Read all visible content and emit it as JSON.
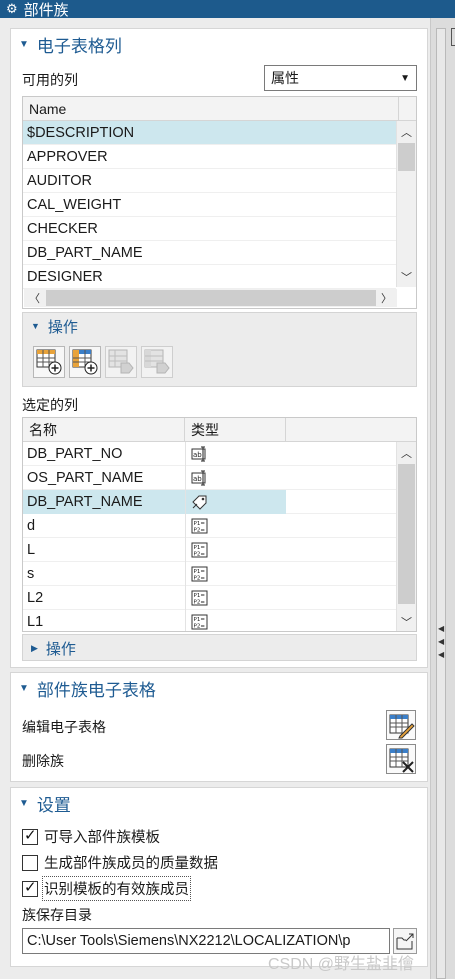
{
  "window": {
    "title": "部件族",
    "icon": "gear-icon"
  },
  "spreadsheet_columns": {
    "title": "电子表格列",
    "available_label": "可用的列",
    "dropdown_value": "属性",
    "available_header": "Name",
    "available_rows": [
      "$DESCRIPTION",
      "APPROVER",
      "AUDITOR",
      "CAL_WEIGHT",
      "CHECKER",
      "DB_PART_NAME",
      "DESIGNER"
    ],
    "selected_available_row": "$DESCRIPTION",
    "ops_label": "操作",
    "selected_label": "选定的列",
    "selected_headers": [
      "名称",
      "类型"
    ],
    "selected_rows": [
      {
        "name": "DB_PART_NO",
        "type_icon": "text-attribute-icon"
      },
      {
        "name": "OS_PART_NAME",
        "type_icon": "text-attribute-icon"
      },
      {
        "name": "DB_PART_NAME",
        "type_icon": "tag-icon"
      },
      {
        "name": "d",
        "type_icon": "expression-icon"
      },
      {
        "name": "L",
        "type_icon": "expression-icon"
      },
      {
        "name": "s",
        "type_icon": "expression-icon"
      },
      {
        "name": "L2",
        "type_icon": "expression-icon"
      },
      {
        "name": "L1",
        "type_icon": "expression-icon"
      }
    ],
    "selected_highlight": "DB_PART_NAME",
    "ops_label_2": "操作"
  },
  "family_spreadsheet": {
    "title": "部件族电子表格",
    "edit_label": "编辑电子表格",
    "delete_label": "删除族"
  },
  "settings": {
    "title": "设置",
    "cb1": {
      "label": "可导入部件族模板",
      "checked": true
    },
    "cb2": {
      "label": "生成部件族成员的质量数据",
      "checked": false
    },
    "cb3": {
      "label": "识别模板的有效族成员",
      "checked": true
    },
    "save_dir_label": "族保存目录",
    "save_dir_value": "C:\\User Tools\\Siemens\\NX2212\\LOCALIZATION\\p"
  },
  "watermark": "CSDN @野生盐韭儈",
  "colors": {
    "title_bar": "#1d5a8c",
    "heading": "#1e5b92",
    "selection": "#cde7ee"
  }
}
